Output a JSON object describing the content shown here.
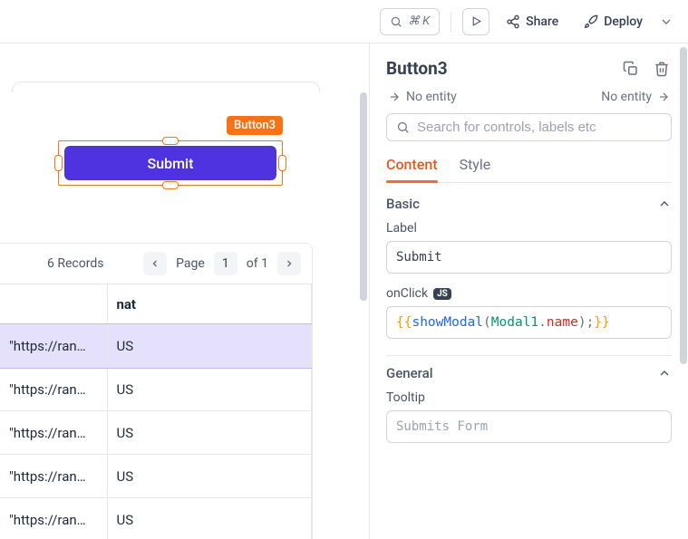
{
  "topbar": {
    "shortcut": "⌘ K",
    "share_label": "Share",
    "deploy_label": "Deploy"
  },
  "canvas": {
    "selected_widget_name": "Button3",
    "submit_label": "Submit"
  },
  "table": {
    "records_label": "6 Records",
    "page_label": "Page",
    "page_current": "1",
    "page_of": "of 1",
    "header_col2": "nat",
    "rows": [
      {
        "c1": "\"https://ran…",
        "c2": "US",
        "selected": true
      },
      {
        "c1": "\"https://ran…",
        "c2": "US",
        "selected": false
      },
      {
        "c1": "\"https://ran…",
        "c2": "US",
        "selected": false
      },
      {
        "c1": "\"https://ran…",
        "c2": "US",
        "selected": false
      },
      {
        "c1": "\"https://ran…",
        "c2": "US",
        "selected": false
      }
    ]
  },
  "panel": {
    "title": "Button3",
    "entity_left": "No entity",
    "entity_right": "No entity",
    "search_placeholder": "Search for controls, labels etc",
    "tabs": {
      "content": "Content",
      "style": "Style"
    },
    "sections": {
      "basic": "Basic",
      "general": "General"
    },
    "fields": {
      "label_label": "Label",
      "label_value": "Submit",
      "onclick_label": "onClick",
      "onclick_code": {
        "open": "{{",
        "fn": "showModal",
        "lp": "(",
        "obj": "Modal1",
        "dot": ".",
        "prop": "name",
        "rp": ")",
        "semi": ";",
        "close": "}}"
      },
      "tooltip_label": "Tooltip",
      "tooltip_value": "Submits Form"
    }
  }
}
